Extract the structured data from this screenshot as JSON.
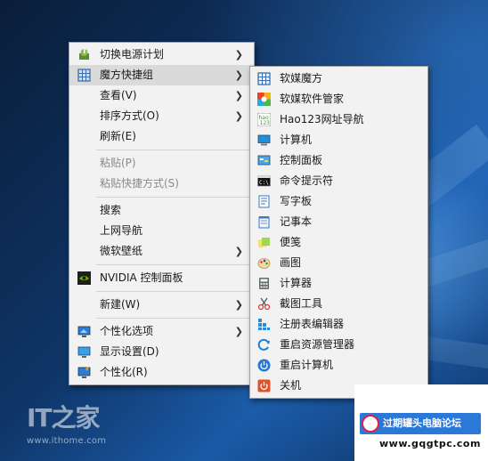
{
  "context_menu": {
    "items": [
      {
        "label": "切换电源计划",
        "icon": "power-plan-icon",
        "submenu": true
      },
      {
        "label": "魔方快捷组",
        "icon": "grid-icon",
        "submenu": true,
        "highlighted": true
      },
      {
        "label": "查看(V)",
        "submenu": true
      },
      {
        "label": "排序方式(O)",
        "submenu": true
      },
      {
        "label": "刷新(E)"
      },
      {
        "label": "粘贴(P)",
        "disabled": true
      },
      {
        "label": "粘贴快捷方式(S)",
        "disabled": true
      },
      {
        "label": "搜索"
      },
      {
        "label": "上网导航"
      },
      {
        "label": "微软壁纸",
        "submenu": true
      },
      {
        "label": "NVIDIA 控制面板",
        "icon": "nvidia-icon"
      },
      {
        "label": "新建(W)",
        "submenu": true
      },
      {
        "label": "个性化选项",
        "icon": "monitor-personalize-icon",
        "submenu": true
      },
      {
        "label": "显示设置(D)",
        "icon": "display-settings-icon"
      },
      {
        "label": "个性化(R)",
        "icon": "personalize-icon"
      }
    ]
  },
  "submenu": {
    "items": [
      {
        "label": "软媒魔方",
        "icon": "grid-icon"
      },
      {
        "label": "软媒软件管家",
        "icon": "software-manager-icon"
      },
      {
        "label": "Hao123网址导航",
        "icon": "hao123-icon"
      },
      {
        "label": "计算机",
        "icon": "computer-icon"
      },
      {
        "label": "控制面板",
        "icon": "control-panel-icon"
      },
      {
        "label": "命令提示符",
        "icon": "command-prompt-icon"
      },
      {
        "label": "写字板",
        "icon": "wordpad-icon"
      },
      {
        "label": "记事本",
        "icon": "notepad-icon"
      },
      {
        "label": "便笺",
        "icon": "sticky-notes-icon"
      },
      {
        "label": "画图",
        "icon": "paint-icon"
      },
      {
        "label": "计算器",
        "icon": "calculator-icon"
      },
      {
        "label": "截图工具",
        "icon": "snipping-tool-icon"
      },
      {
        "label": "注册表编辑器",
        "icon": "registry-editor-icon"
      },
      {
        "label": "重启资源管理器",
        "icon": "restart-explorer-icon"
      },
      {
        "label": "重启计算机",
        "icon": "restart-computer-icon"
      },
      {
        "label": "关机",
        "icon": "shutdown-icon"
      }
    ]
  },
  "arrow_glyph": "❯",
  "watermarks": {
    "ithome_logo": "IT之家",
    "ithome_url": "www.ithome.com",
    "forum_title": "过期罐头电脑论坛",
    "forum_url": "www.gqgtpc.com"
  },
  "colors": {
    "highlight": "#dadada",
    "menu_bg": "#f2f2f2",
    "disabled_text": "#8a8a8a"
  }
}
